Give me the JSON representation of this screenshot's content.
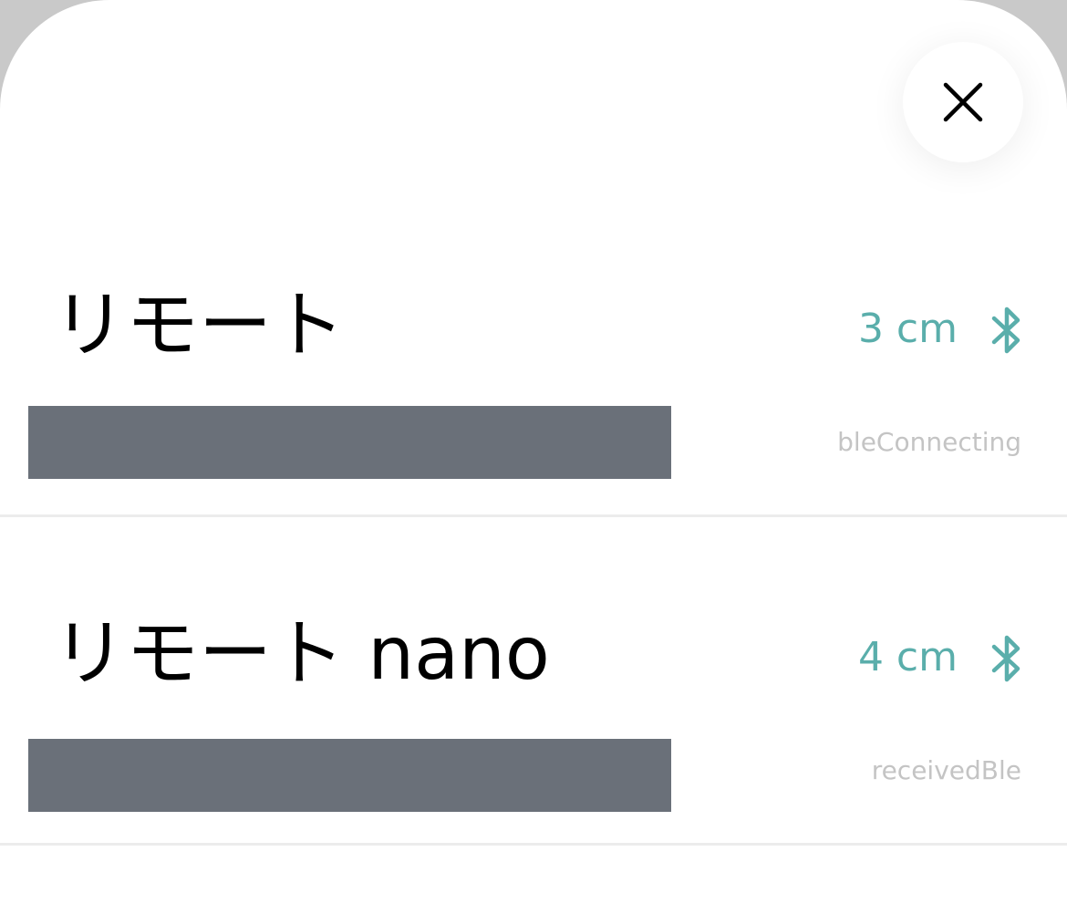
{
  "close_button": {
    "icon": "close-icon"
  },
  "devices": [
    {
      "name": "リモート",
      "distance": "3 cm",
      "status": "bleConnecting",
      "connection_icon": "bluetooth-icon"
    },
    {
      "name": "リモート nano",
      "distance": "4 cm",
      "status": "receivedBle",
      "connection_icon": "bluetooth-icon"
    }
  ],
  "colors": {
    "accent": "#5aaeab",
    "status_text": "#c4c4c4",
    "redaction": "#6a7079",
    "divider": "#ececec"
  }
}
